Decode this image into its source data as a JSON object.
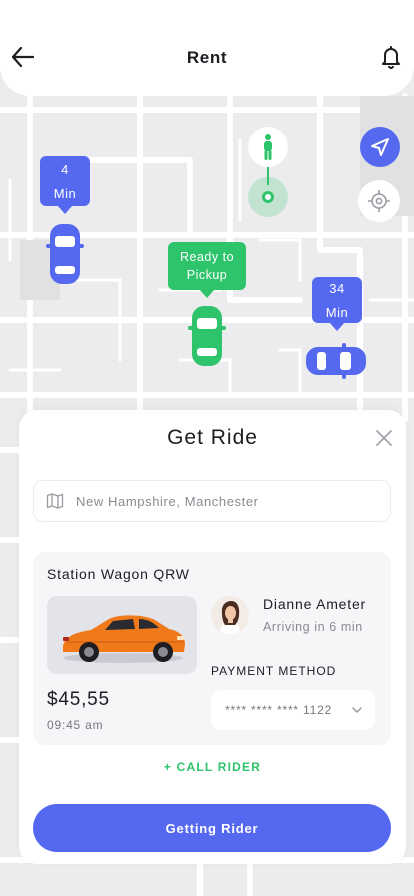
{
  "header": {
    "title": "Rent",
    "back_icon": "arrow-left-icon",
    "bell_icon": "bell-icon"
  },
  "map": {
    "eta_left": {
      "value": "4",
      "unit": "Min"
    },
    "ready_pickup": {
      "line1": "Ready to",
      "line2": "Pickup"
    },
    "eta_right": {
      "value": "34",
      "unit": "Min"
    },
    "nav_icon": "navigation-arrow-icon",
    "locate_icon": "crosshair-icon"
  },
  "sheet": {
    "title": "Get Ride",
    "location_placeholder": "New Hampshire, Manchester",
    "car_name": "Station Wagon QRW",
    "price": "$45,55",
    "time": "09:45 am",
    "driver_name": "Dianne Ameter",
    "arriving": "Arriving in 6 min",
    "payment_label": "PAYMENT METHOD",
    "payment_value": "**** **** **** 1122",
    "call_rider": "+ CALL RIDER",
    "cta": "Getting Rider"
  },
  "colors": {
    "accent": "#5569f0",
    "green": "#2ec46b",
    "car_orange": "#f07a1a"
  }
}
